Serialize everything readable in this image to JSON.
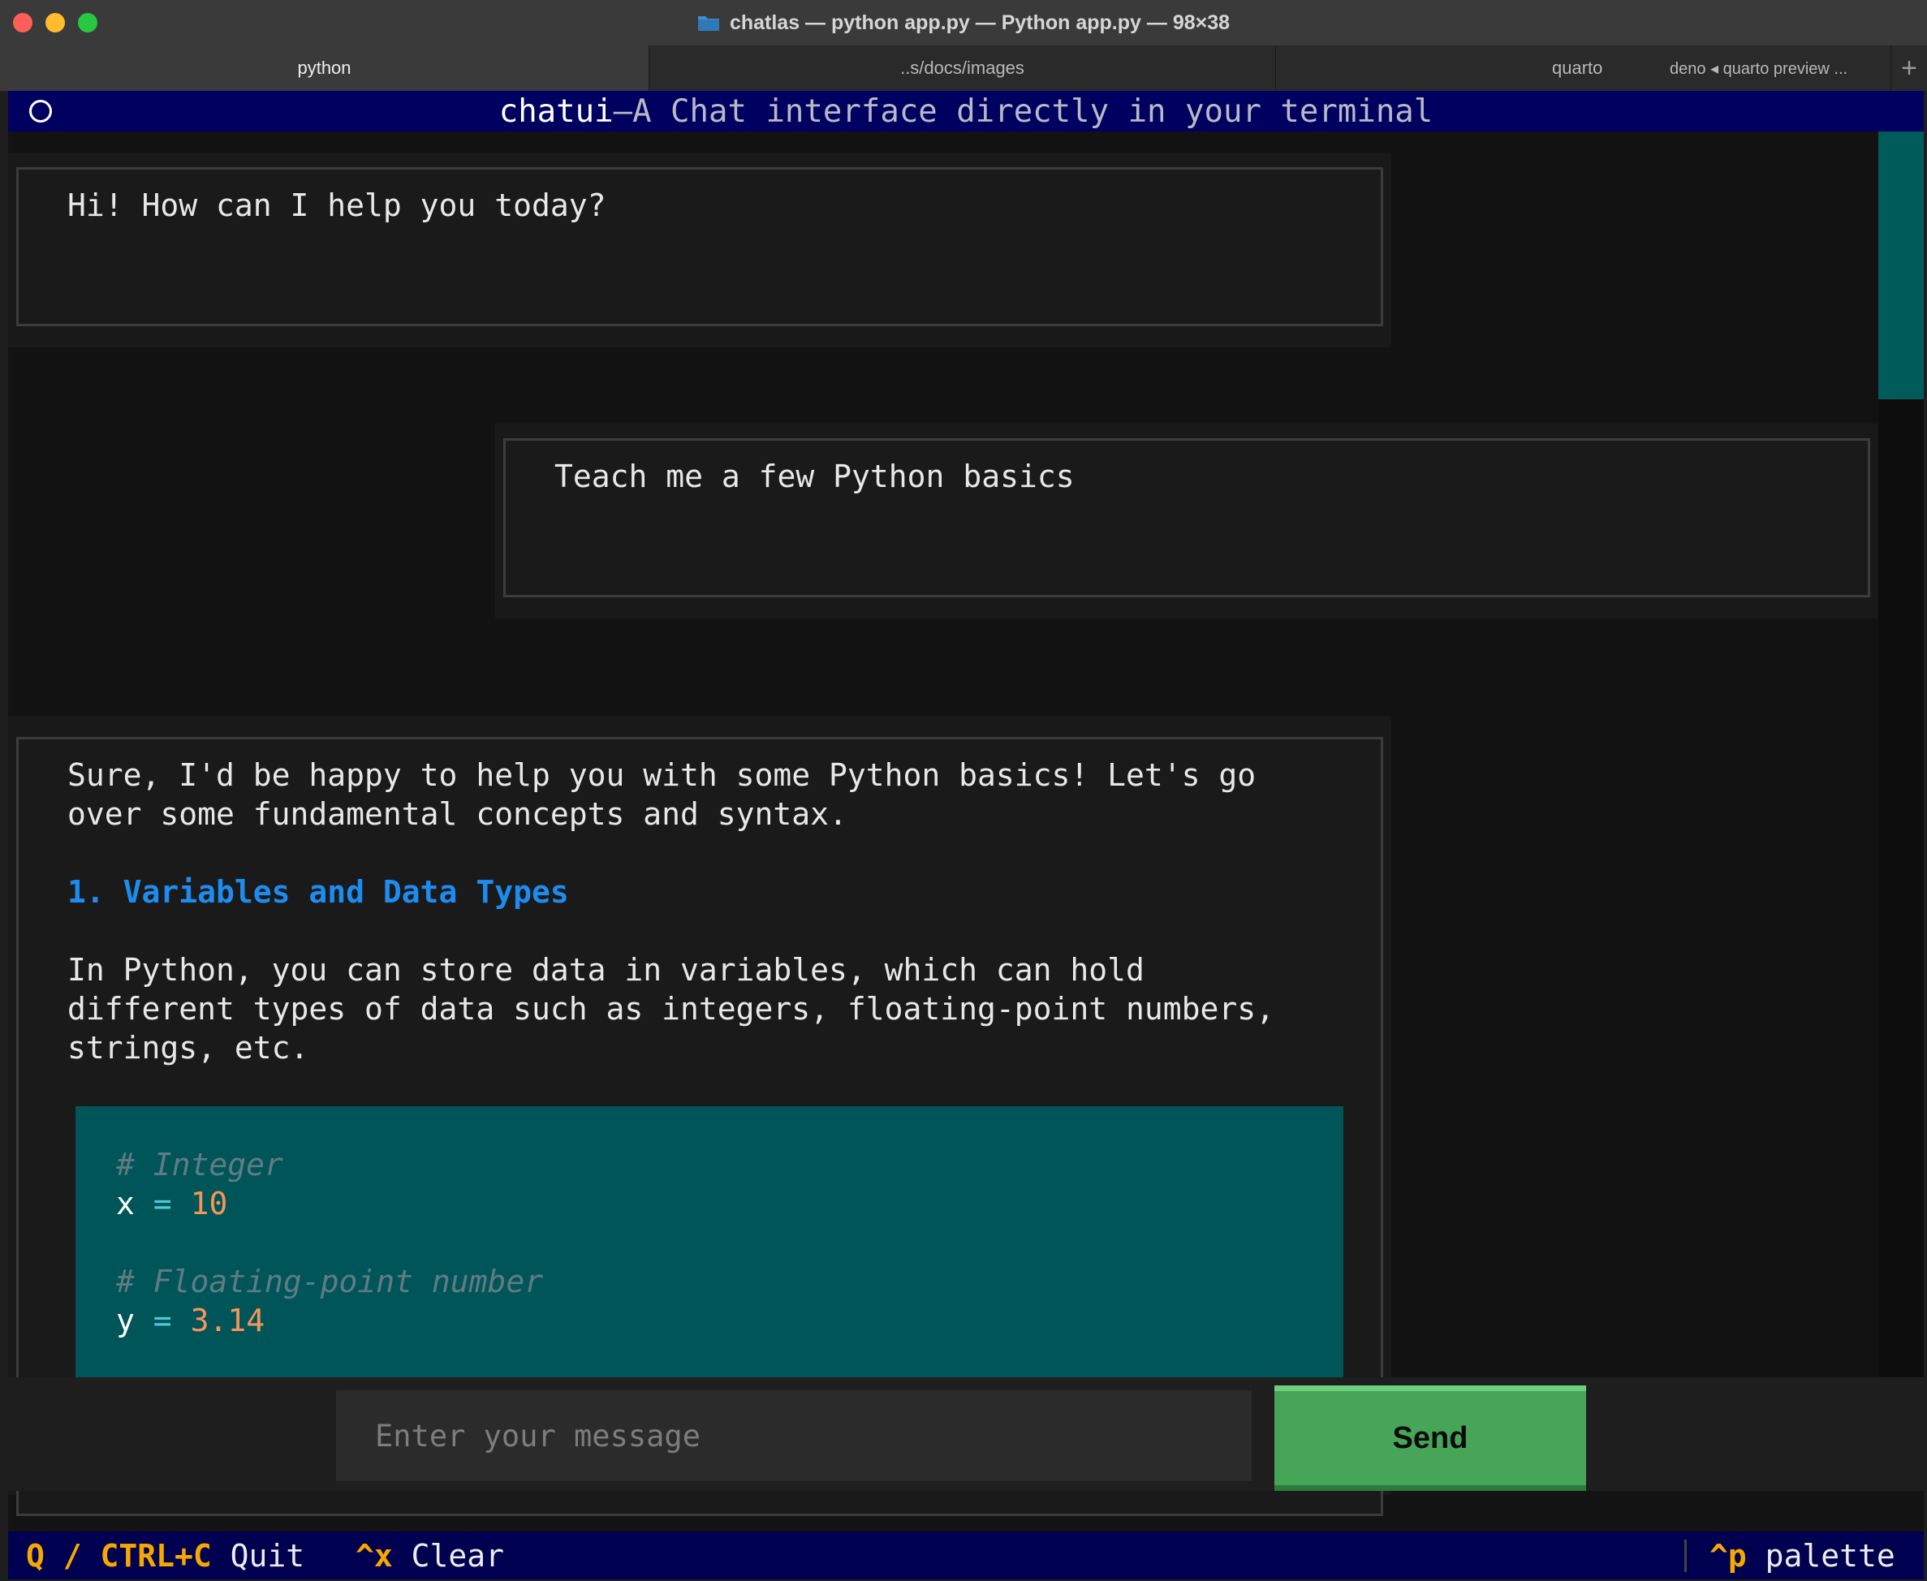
{
  "window": {
    "title": "chatlas — python app.py — Python app.py — 98×38",
    "folder_icon": "folder-icon"
  },
  "tabs": [
    {
      "label": "python",
      "active": true
    },
    {
      "label": "..s/docs/images",
      "active": false
    },
    {
      "label": "quarto",
      "active": false
    },
    {
      "label": "deno ◂ quarto preview ...",
      "active": false
    }
  ],
  "tab_add_label": "+",
  "header": {
    "app_name": "chatui",
    "separator": " — ",
    "subtitle": "A Chat interface directly in your terminal",
    "icon": "circle-icon"
  },
  "messages": [
    {
      "role": "assistant",
      "text": "Hi! How can I help you today?"
    },
    {
      "role": "user",
      "text": "Teach me a few Python basics"
    },
    {
      "role": "assistant",
      "intro_line1": "Sure, I'd be happy to help you with some Python basics! Let's go",
      "intro_line2": "over some fundamental concepts and syntax.",
      "heading": "1. Variables and Data Types",
      "para_line1": "In Python, you can store data in variables, which can hold",
      "para_line2": "different types of data such as integers, floating-point numbers,",
      "para_line3": "strings, etc.",
      "code": {
        "comment1": "# Integer",
        "var1": "x",
        "op1": "=",
        "val1": "10",
        "comment2": "# Floating-point number",
        "var2": "y",
        "op2": "=",
        "val2": "3.14"
      }
    }
  ],
  "input": {
    "placeholder": "Enter your message",
    "value": ""
  },
  "send_button": {
    "label": "Send",
    "color": "#47a558"
  },
  "footer": {
    "quit_key": "Q / CTRL+C",
    "quit_label": "Quit",
    "clear_key": "^x",
    "clear_label": "Clear",
    "palette_key": "^p",
    "palette_label": "palette"
  },
  "colors": {
    "header_bg": "#000060",
    "heading": "#1d8cf0",
    "code_bg": "#005558",
    "accent_key": "#f7a800"
  }
}
